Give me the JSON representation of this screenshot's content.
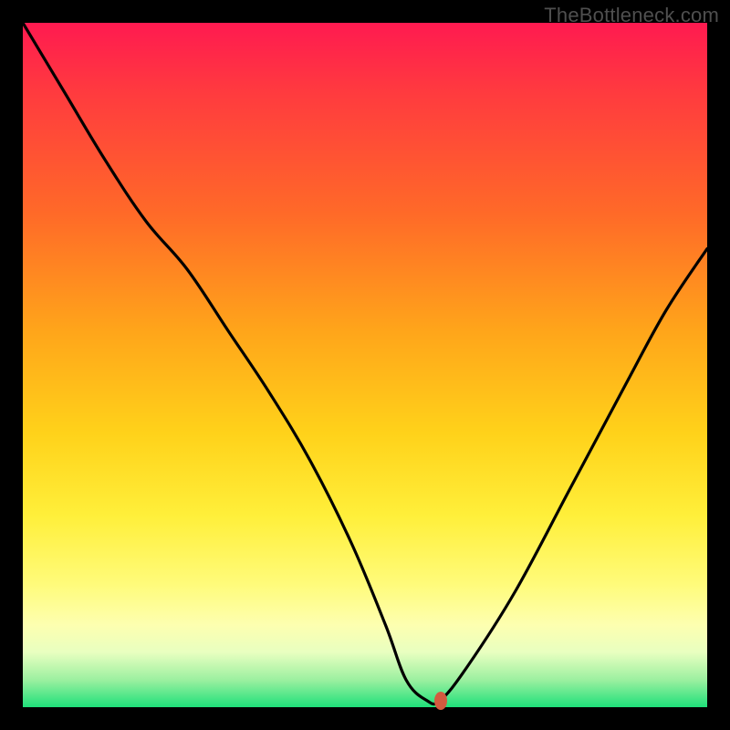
{
  "watermark": "TheBottleneck.com",
  "chart_data": {
    "type": "line",
    "title": "",
    "xlabel": "",
    "ylabel": "",
    "xlim": [
      0,
      100
    ],
    "ylim": [
      0,
      100
    ],
    "grid": false,
    "series": [
      {
        "name": "curve",
        "x": [
          0,
          6,
          12,
          18,
          24,
          30,
          36,
          42,
          48,
          53,
          56,
          59,
          61,
          65,
          72,
          80,
          88,
          94,
          100
        ],
        "values": [
          100,
          90,
          80,
          71,
          64,
          55,
          46,
          36,
          24,
          12,
          4,
          1,
          1,
          6,
          17,
          32,
          47,
          58,
          67
        ]
      }
    ],
    "marker": {
      "x": 61,
      "y": 1,
      "shape": "rounded-rect",
      "color": "#d45a3f"
    },
    "background_gradient": {
      "top": "#ff1a50",
      "mid": "#ffd21a",
      "bottom": "#1fe07a"
    },
    "frame_color": "#000000"
  }
}
